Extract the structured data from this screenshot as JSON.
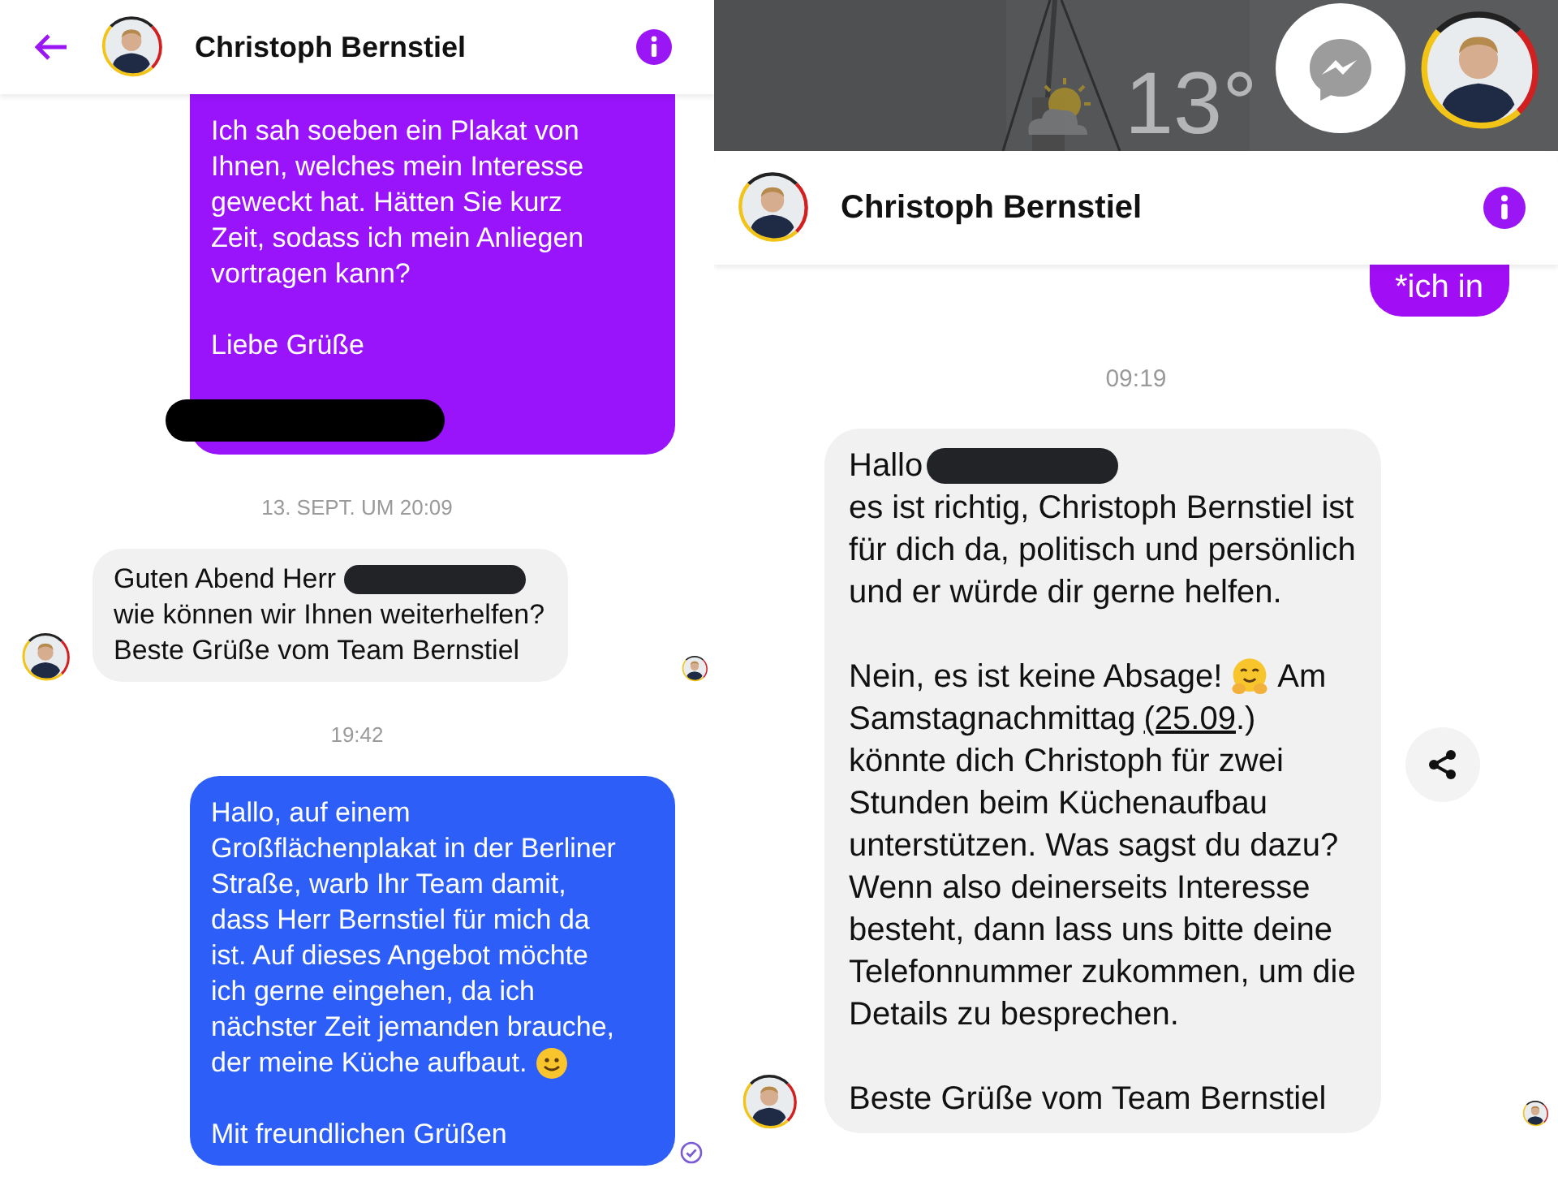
{
  "left": {
    "header": {
      "title": "Christoph Bernstiel"
    },
    "items": [
      {
        "kind": "outgoing",
        "color": "#9a14fb",
        "delivered": false,
        "paragraphs": [
          [
            "Ich sah soeben ein Plakat von",
            "Ihnen, welches mein Interesse",
            "geweckt hat. Hätten Sie kurz",
            "Zeit, sodass ich mein Anliegen",
            "vortragen kann?"
          ],
          [
            "Liebe Grüße"
          ],
          [
            [
              {
                "kind": "redaction"
              }
            ]
          ]
        ]
      },
      {
        "kind": "time",
        "text": "13. SEPT. UM 20:09"
      },
      {
        "kind": "incoming",
        "avatar": true,
        "seen": true,
        "paragraphs": [
          [
            [
              "Guten Abend Herr",
              {
                "kind": "redaction"
              }
            ],
            "wie können wir Ihnen weiterhelfen?",
            "Beste Grüße vom Team Bernstiel"
          ]
        ]
      },
      {
        "kind": "time",
        "text": "19:42"
      },
      {
        "kind": "outgoing",
        "color": "#2d5ff8",
        "delivered": true,
        "paragraphs": [
          [
            "Hallo, auf einem",
            "Großflächenplakat in der Berliner",
            "Straße, warb Ihr Team damit,",
            "dass Herr Bernstiel für mich da",
            "ist. Auf dieses Angebot möchte",
            "ich gerne eingehen, da ich",
            "nächster Zeit jemanden brauche,",
            [
              "der meine Küche aufbaut.",
              {
                "kind": "smile"
              }
            ]
          ],
          [
            "Mit freundlichen Grüßen"
          ]
        ]
      }
    ]
  },
  "right": {
    "home": {
      "temperature": "13°"
    },
    "header": {
      "title": "Christoph Bernstiel"
    },
    "items": [
      {
        "kind": "outgoing",
        "color": "#a10ef6",
        "delivered": false,
        "paragraphs": [
          [
            "*ich in"
          ]
        ]
      },
      {
        "kind": "time",
        "text": "09:19"
      },
      {
        "kind": "incoming",
        "avatar": true,
        "seen": true,
        "share": true,
        "paragraphs": [
          [
            [
              "Hallo",
              {
                "kind": "redaction"
              }
            ],
            "es ist richtig, Christoph Bernstiel ist",
            "für dich da, politisch und persönlich",
            "und er würde dir gerne helfen."
          ],
          [
            [
              "Nein, es ist keine Absage!",
              {
                "kind": "hug"
              },
              "Am"
            ],
            [
              "Samstagnachmittag",
              {
                "kind": "link",
                "text": "(25.09"
              },
              ".)"
            ],
            "könnte dich Christoph für zwei",
            "Stunden beim Küchenaufbau",
            "unterstützen. Was sagst du dazu?",
            "Wenn also deinerseits Interesse",
            "besteht, dann lass uns bitte deine",
            "Telefonnummer zukommen, um die",
            "Details zu besprechen."
          ],
          [
            "Beste Grüße vom Team Bernstiel"
          ]
        ]
      }
    ]
  }
}
